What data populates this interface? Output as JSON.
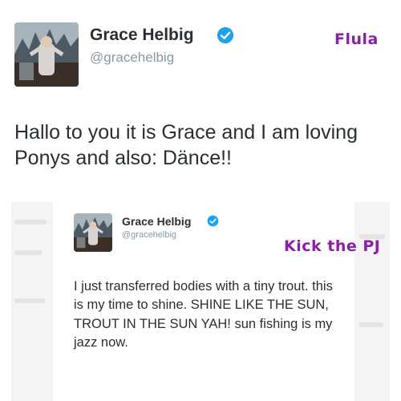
{
  "tweet_top": {
    "name": "Grace Helbig",
    "handle": "@gracehelbig",
    "text": "Hallo to you it is Grace and I am loving Ponys and also: Dänce!!",
    "verified_icon": "verified-badge-icon",
    "verified_color": "#1da1f2"
  },
  "tweet_bottom": {
    "name": "Grace Helbig",
    "handle": "@gracehelbig",
    "text": "I just transferred bodies with a tiny trout. this is my time to shine. SHINE LIKE THE SUN, TROUT IN THE SUN YAH! sun fishing is my jazz now.",
    "verified_icon": "verified-badge-icon",
    "verified_color": "#1da1f2"
  },
  "labels": {
    "top": "Flula",
    "bottom": "Kick the PJ",
    "color": "#8b1fa9"
  }
}
